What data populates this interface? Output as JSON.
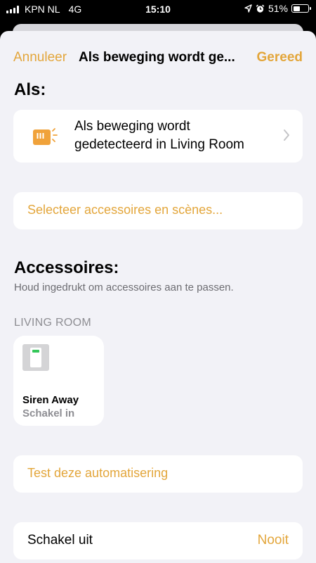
{
  "status_bar": {
    "carrier": "KPN NL",
    "network": "4G",
    "time": "15:10",
    "battery": "51%",
    "battery_level": 0.51,
    "icons": [
      "signal-bars-icon",
      "location-arrow-icon",
      "alarm-clock-icon",
      "battery-icon"
    ]
  },
  "nav": {
    "cancel_label": "Annuleer",
    "title": "Als beweging wordt ge...",
    "done_label": "Gereed"
  },
  "trigger": {
    "heading": "Als:",
    "icon": "motion-sensor-icon",
    "text": "Als beweging wordt gedetecteerd in Living Room"
  },
  "select_accessories": {
    "label": "Selecteer accessoires en scènes..."
  },
  "accessories": {
    "heading": "Accessoires:",
    "hint": "Houd ingedrukt om accessoires aan te passen.",
    "room": "LIVING ROOM",
    "tiles": [
      {
        "icon": "switch-icon",
        "name": "Siren Away",
        "state": "Schakel in"
      }
    ]
  },
  "test": {
    "label": "Test deze automatisering"
  },
  "turn_off": {
    "label": "Schakel uit",
    "value": "Nooit"
  },
  "colors": {
    "accent": "#e3a63b",
    "background": "#f2f2f7",
    "card": "#ffffff",
    "secondary_text": "#8e8e93",
    "indicator_green": "#34c759"
  }
}
